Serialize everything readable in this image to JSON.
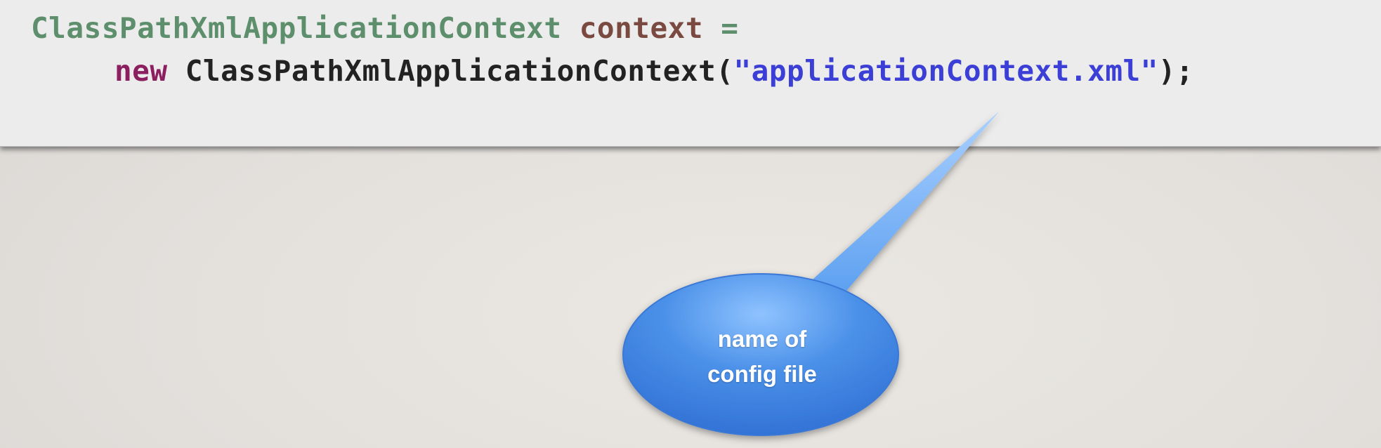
{
  "code": {
    "line1": {
      "type": "ClassPathXmlApplicationContext",
      "variable": "context",
      "operator": "="
    },
    "line2": {
      "keyword": "new",
      "constructor": "ClassPathXmlApplicationContext(",
      "argument": "\"applicationContext.xml\"",
      "closing": ");"
    }
  },
  "callout": {
    "line1": "name of",
    "line2": "config file",
    "color": "#4a90e8"
  }
}
